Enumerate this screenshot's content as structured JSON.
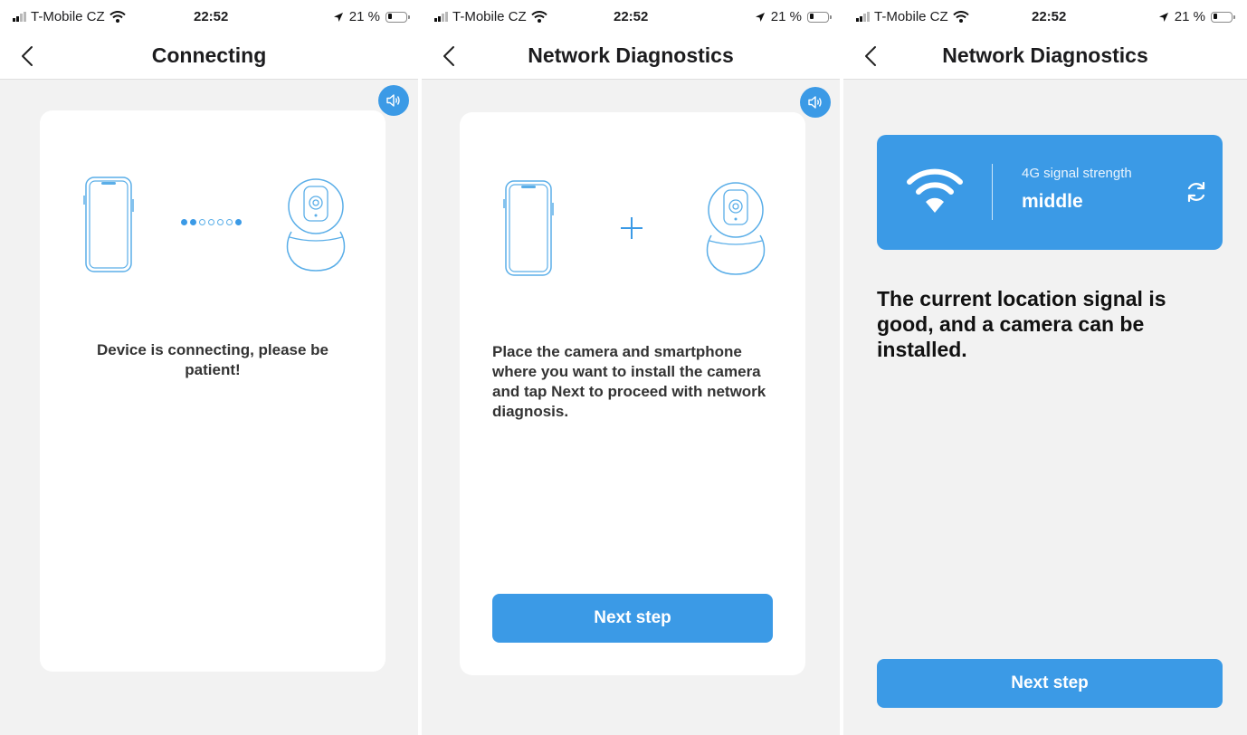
{
  "status_bar": {
    "carrier": "T-Mobile CZ",
    "time": "22:52",
    "battery": "21 %"
  },
  "screens": [
    {
      "title": "Connecting",
      "message": "Device is connecting, please be patient!"
    },
    {
      "title": "Network Diagnostics",
      "message": "Place the camera and smartphone where you want to install the camera and tap Next to proceed with network diagnosis.",
      "button": "Next step"
    },
    {
      "title": "Network Diagnostics",
      "signal_label": "4G signal strength",
      "signal_value": "middle",
      "message": "The current location signal is good, and a camera can be installed.",
      "button": "Next step"
    }
  ],
  "colors": {
    "accent": "#3b9ae6",
    "background": "#f2f2f2",
    "card": "#ffffff"
  },
  "icons": [
    "back-chevron-icon",
    "speaker-icon",
    "phone-illustration",
    "camera-illustration",
    "plus-icon",
    "wifi-icon",
    "refresh-icon",
    "location-arrow-icon",
    "wifi-status-icon",
    "battery-icon",
    "signal-bars-icon"
  ]
}
